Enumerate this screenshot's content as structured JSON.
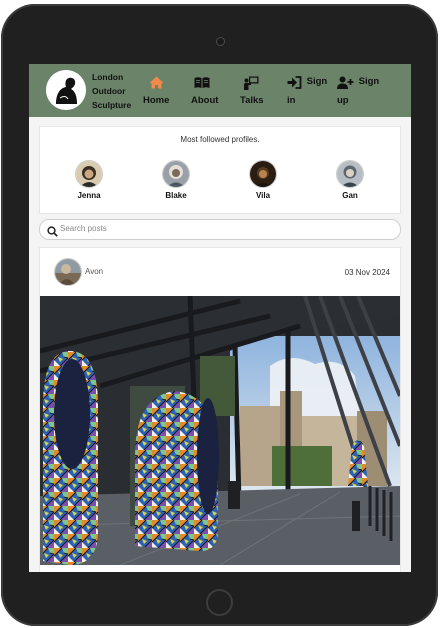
{
  "brand": {
    "line1": "London",
    "line2": "Outdoor",
    "line3": "Sculpture"
  },
  "nav": {
    "items": [
      {
        "label": "Home",
        "icon": "home-icon",
        "active": true
      },
      {
        "label": "About",
        "icon": "book-icon",
        "active": false
      },
      {
        "label": "Talks",
        "icon": "presenter-icon",
        "active": false
      },
      {
        "label_line1": "Sign",
        "label_line2": "in",
        "icon": "sign-in-icon",
        "active": false
      },
      {
        "label_line1": "Sign",
        "label_line2": "up",
        "icon": "add-user-icon",
        "active": false
      }
    ]
  },
  "colors": {
    "navbar": "#6b8469",
    "active_nav": "#f08a4b"
  },
  "followed": {
    "title": "Most followed profiles.",
    "profiles": [
      {
        "name": "Jenna"
      },
      {
        "name": "Blake"
      },
      {
        "name": "Vila"
      },
      {
        "name": "Gan"
      }
    ]
  },
  "search": {
    "placeholder": "Search posts",
    "value": ""
  },
  "post": {
    "author": "Avon",
    "date": "03 Nov 2024"
  }
}
